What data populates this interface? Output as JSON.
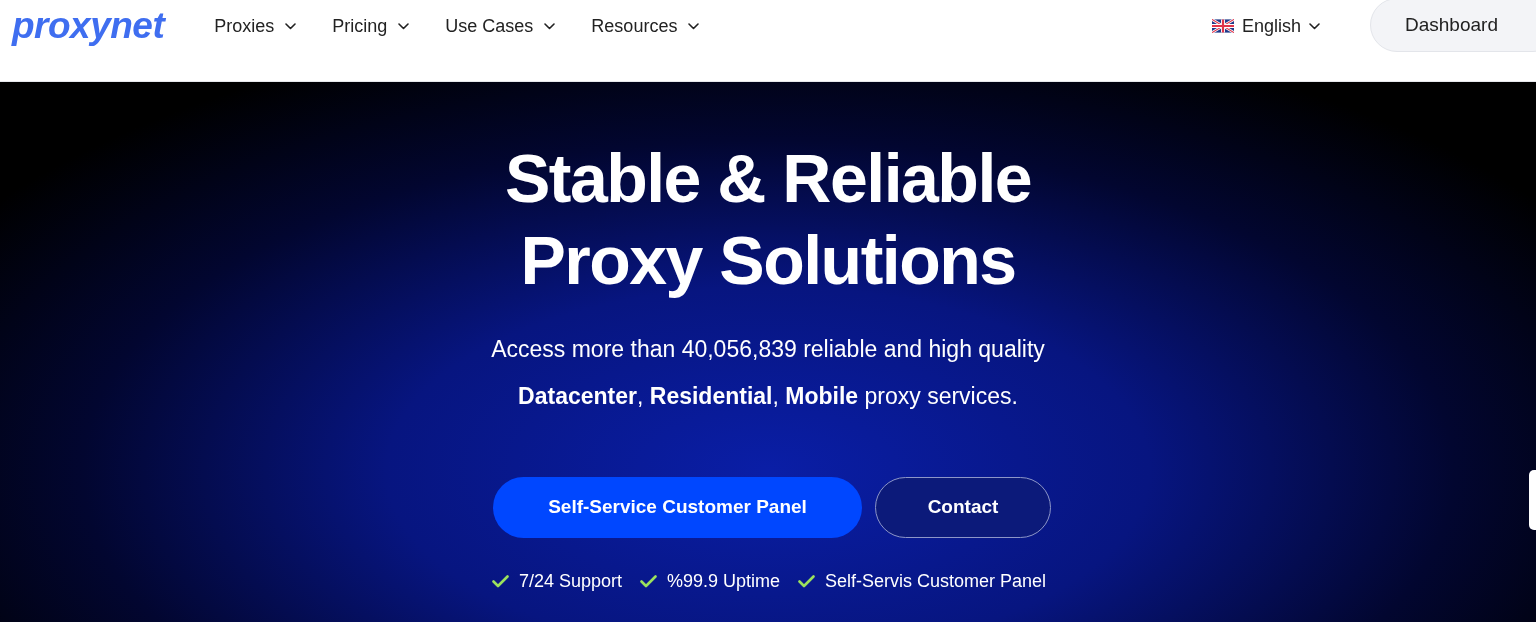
{
  "header": {
    "logo": "proxynet",
    "nav": [
      {
        "label": "Proxies"
      },
      {
        "label": "Pricing"
      },
      {
        "label": "Use Cases"
      },
      {
        "label": "Resources"
      }
    ],
    "language": {
      "label": "English"
    },
    "dashboard_button": "Dashboard"
  },
  "hero": {
    "title_lines": [
      "Stable & Reliable",
      "Proxy Solutions"
    ],
    "subtitle_lines": [
      "Access more than 40,056,839 reliable and high quality",
      "**Datacenter**, **Residential**, **Mobile** proxy services."
    ],
    "buttons": [
      {
        "label": "Self-Service Customer Panel",
        "kind": "primary"
      },
      {
        "label": "Contact",
        "kind": "outline"
      }
    ],
    "features": [
      "7/24 Support",
      "%99.9 Uptime",
      "Self-Servis Customer Panel"
    ]
  }
}
